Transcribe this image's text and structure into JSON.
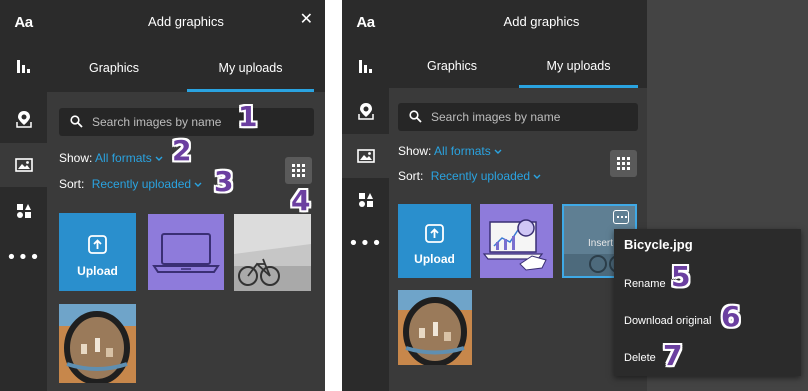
{
  "panels": [
    {
      "header": {
        "title": "Add graphics"
      },
      "tabs": [
        {
          "label": "Graphics"
        },
        {
          "label": "My uploads"
        }
      ],
      "search": {
        "placeholder": "Search images by name"
      },
      "filters": {
        "show_label": "Show:",
        "show_value": "All formats",
        "sort_label": "Sort:",
        "sort_value": "Recently uploaded"
      },
      "tiles": {
        "upload_label": "Upload"
      }
    },
    {
      "header": {
        "title": "Add graphics"
      },
      "tabs": [
        {
          "label": "Graphics"
        },
        {
          "label": "My uploads"
        }
      ],
      "search": {
        "placeholder": "Search images by name"
      },
      "filters": {
        "show_label": "Show:",
        "show_value": "All formats",
        "sort_label": "Sort:",
        "sort_value": "Recently uploaded"
      },
      "tiles": {
        "upload_label": "Upload",
        "insert_label": "Insert"
      }
    }
  ],
  "context_menu": {
    "title": "Bicycle.jpg",
    "items": [
      "Rename",
      "Download original",
      "Delete"
    ]
  },
  "callouts": [
    "1",
    "2",
    "3",
    "4",
    "5",
    "6",
    "7"
  ],
  "colors": {
    "accent": "#2aa3e0",
    "panel": "#3a3a3a",
    "header": "#2b2b2b",
    "callout": "#6b3fa0",
    "upload_tile": "#2a8fcd",
    "laptop_tile": "#8e7bdb"
  }
}
